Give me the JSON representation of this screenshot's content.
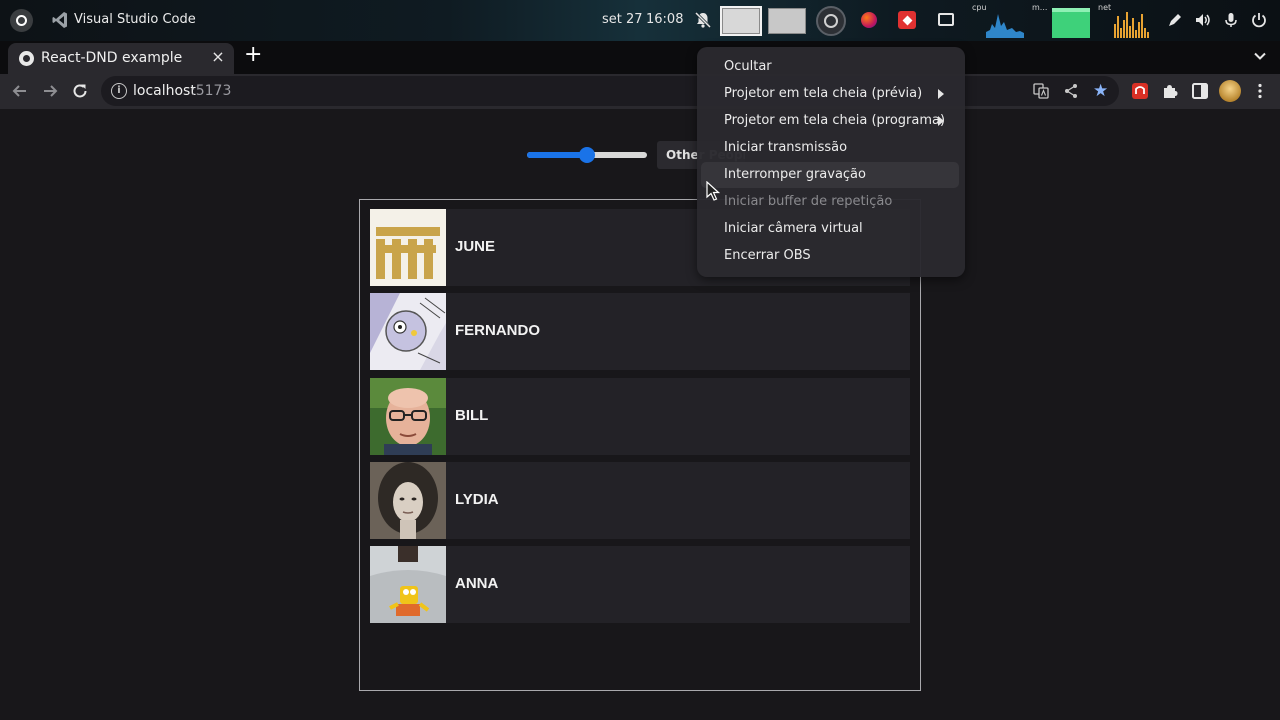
{
  "topbar": {
    "app_name": "Visual Studio Code",
    "date": "set 27",
    "time": "16:08",
    "monitors": {
      "cpu_label": "cpu",
      "mem_label": "m...",
      "net_label": "net"
    }
  },
  "browser": {
    "tab_title": "React-DND example",
    "url_host": "localhost",
    "url_port": ":5173"
  },
  "page": {
    "slider": {
      "value_fraction": 0.5
    },
    "other_people_label": "Other People",
    "people": [
      {
        "name": "JUNE"
      },
      {
        "name": "FERNANDO"
      },
      {
        "name": "BILL"
      },
      {
        "name": "LYDIA"
      },
      {
        "name": "ANNA"
      }
    ]
  },
  "obs_menu": {
    "items": [
      {
        "label": "Ocultar",
        "submenu": false,
        "enabled": true
      },
      {
        "label": "Projetor em tela cheia (prévia)",
        "submenu": true,
        "enabled": true
      },
      {
        "label": "Projetor em tela cheia (programa)",
        "submenu": true,
        "enabled": true
      },
      {
        "label": "Iniciar transmissão",
        "submenu": false,
        "enabled": true
      },
      {
        "label": "Interromper gravação",
        "submenu": false,
        "enabled": true,
        "hovered": true
      },
      {
        "label": "Iniciar buffer de repetição",
        "submenu": false,
        "enabled": false
      },
      {
        "label": "Iniciar câmera virtual",
        "submenu": false,
        "enabled": true
      },
      {
        "label": "Encerrar OBS",
        "submenu": false,
        "enabled": true
      }
    ]
  },
  "colors": {
    "accent": "#1a73e8",
    "star": "#8ab4f8",
    "page_bg": "#18171a",
    "card_bg": "#232227"
  }
}
